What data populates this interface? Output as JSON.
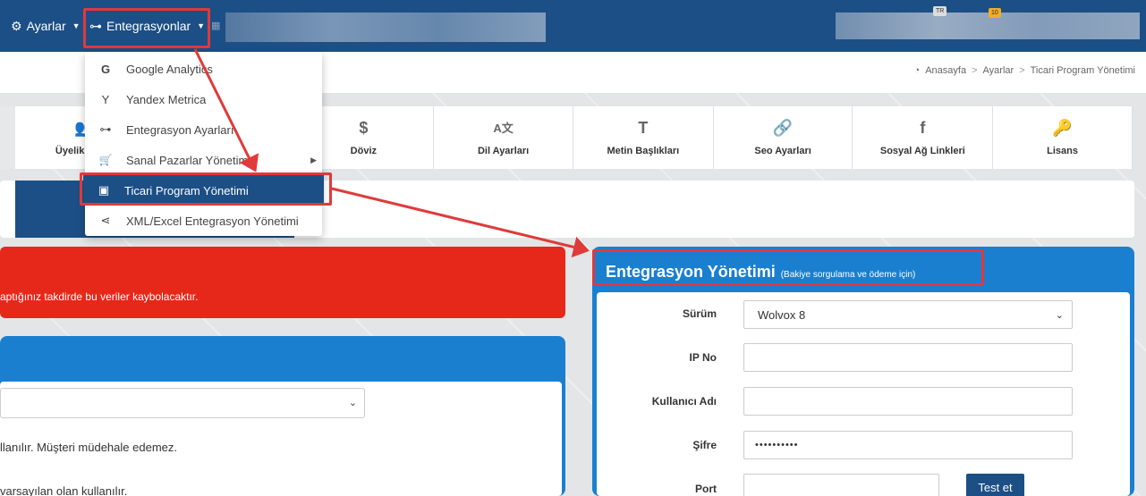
{
  "topbar": {
    "settings_label": "Ayarlar",
    "integrations_label": "Entegrasyonlar",
    "badge_lang": "TR",
    "badge_count": "10"
  },
  "dropdown": {
    "items": [
      {
        "icon": "google-icon",
        "glyph": "G",
        "label": "Google Analytics"
      },
      {
        "icon": "yandex-icon",
        "glyph": "Y",
        "label": "Yandex Metrica"
      },
      {
        "icon": "sitemap-icon",
        "glyph": "⊶",
        "label": "Entegrasyon Ayarları"
      },
      {
        "icon": "cart-icon",
        "glyph": "🛒",
        "label": "Sanal Pazarlar Yönetimi"
      },
      {
        "icon": "laptop-icon",
        "glyph": "▣",
        "label": "Ticari Program Yönetimi"
      },
      {
        "icon": "share-icon",
        "glyph": "⋖",
        "label": "XML/Excel Entegrasyon Yönetimi"
      }
    ]
  },
  "breadcrumb": {
    "home": "Anasayfa",
    "settings": "Ayarlar",
    "current": "Ticari Program Yönetimi"
  },
  "tiles": [
    {
      "icon": "users-icon",
      "glyph": "👥",
      "label": "Üyelik ve Ba"
    },
    {
      "icon": "dollar-icon",
      "glyph": "$",
      "label": "Döviz"
    },
    {
      "icon": "language-icon",
      "glyph": "A文",
      "label": "Dil Ayarları"
    },
    {
      "icon": "text-height-icon",
      "glyph": "T",
      "label": "Metin Başlıkları"
    },
    {
      "icon": "link-icon",
      "glyph": "🔗",
      "label": "Seo Ayarları"
    },
    {
      "icon": "facebook-icon",
      "glyph": "f",
      "label": "Sosyal Ağ Linkleri"
    },
    {
      "icon": "key-icon",
      "glyph": "🔑",
      "label": "Lisans"
    }
  ],
  "alert": {
    "text": "aptığınız takdirde bu veriler kaybolacaktır."
  },
  "left": {
    "text1": "llanılır. Müşteri müdehale edemez.",
    "text2": "varsayılan olan kullanılır."
  },
  "integration": {
    "title": "Entegrasyon Yönetimi",
    "subtitle": "(Bakiye sorgulama ve ödeme için)",
    "version_label": "Sürüm",
    "version_value": "Wolvox 8",
    "ip_label": "IP No",
    "ip_value": "",
    "user_label": "Kullanıcı Adı",
    "user_value": "",
    "password_label": "Şifre",
    "password_value": "••••••••••",
    "port_label": "Port",
    "port_value": "",
    "test_label": "Test et"
  },
  "colors": {
    "navy": "#1b4f86",
    "blue": "#1a7fcf",
    "red": "#e6281a",
    "highlight": "#e03a3a"
  }
}
